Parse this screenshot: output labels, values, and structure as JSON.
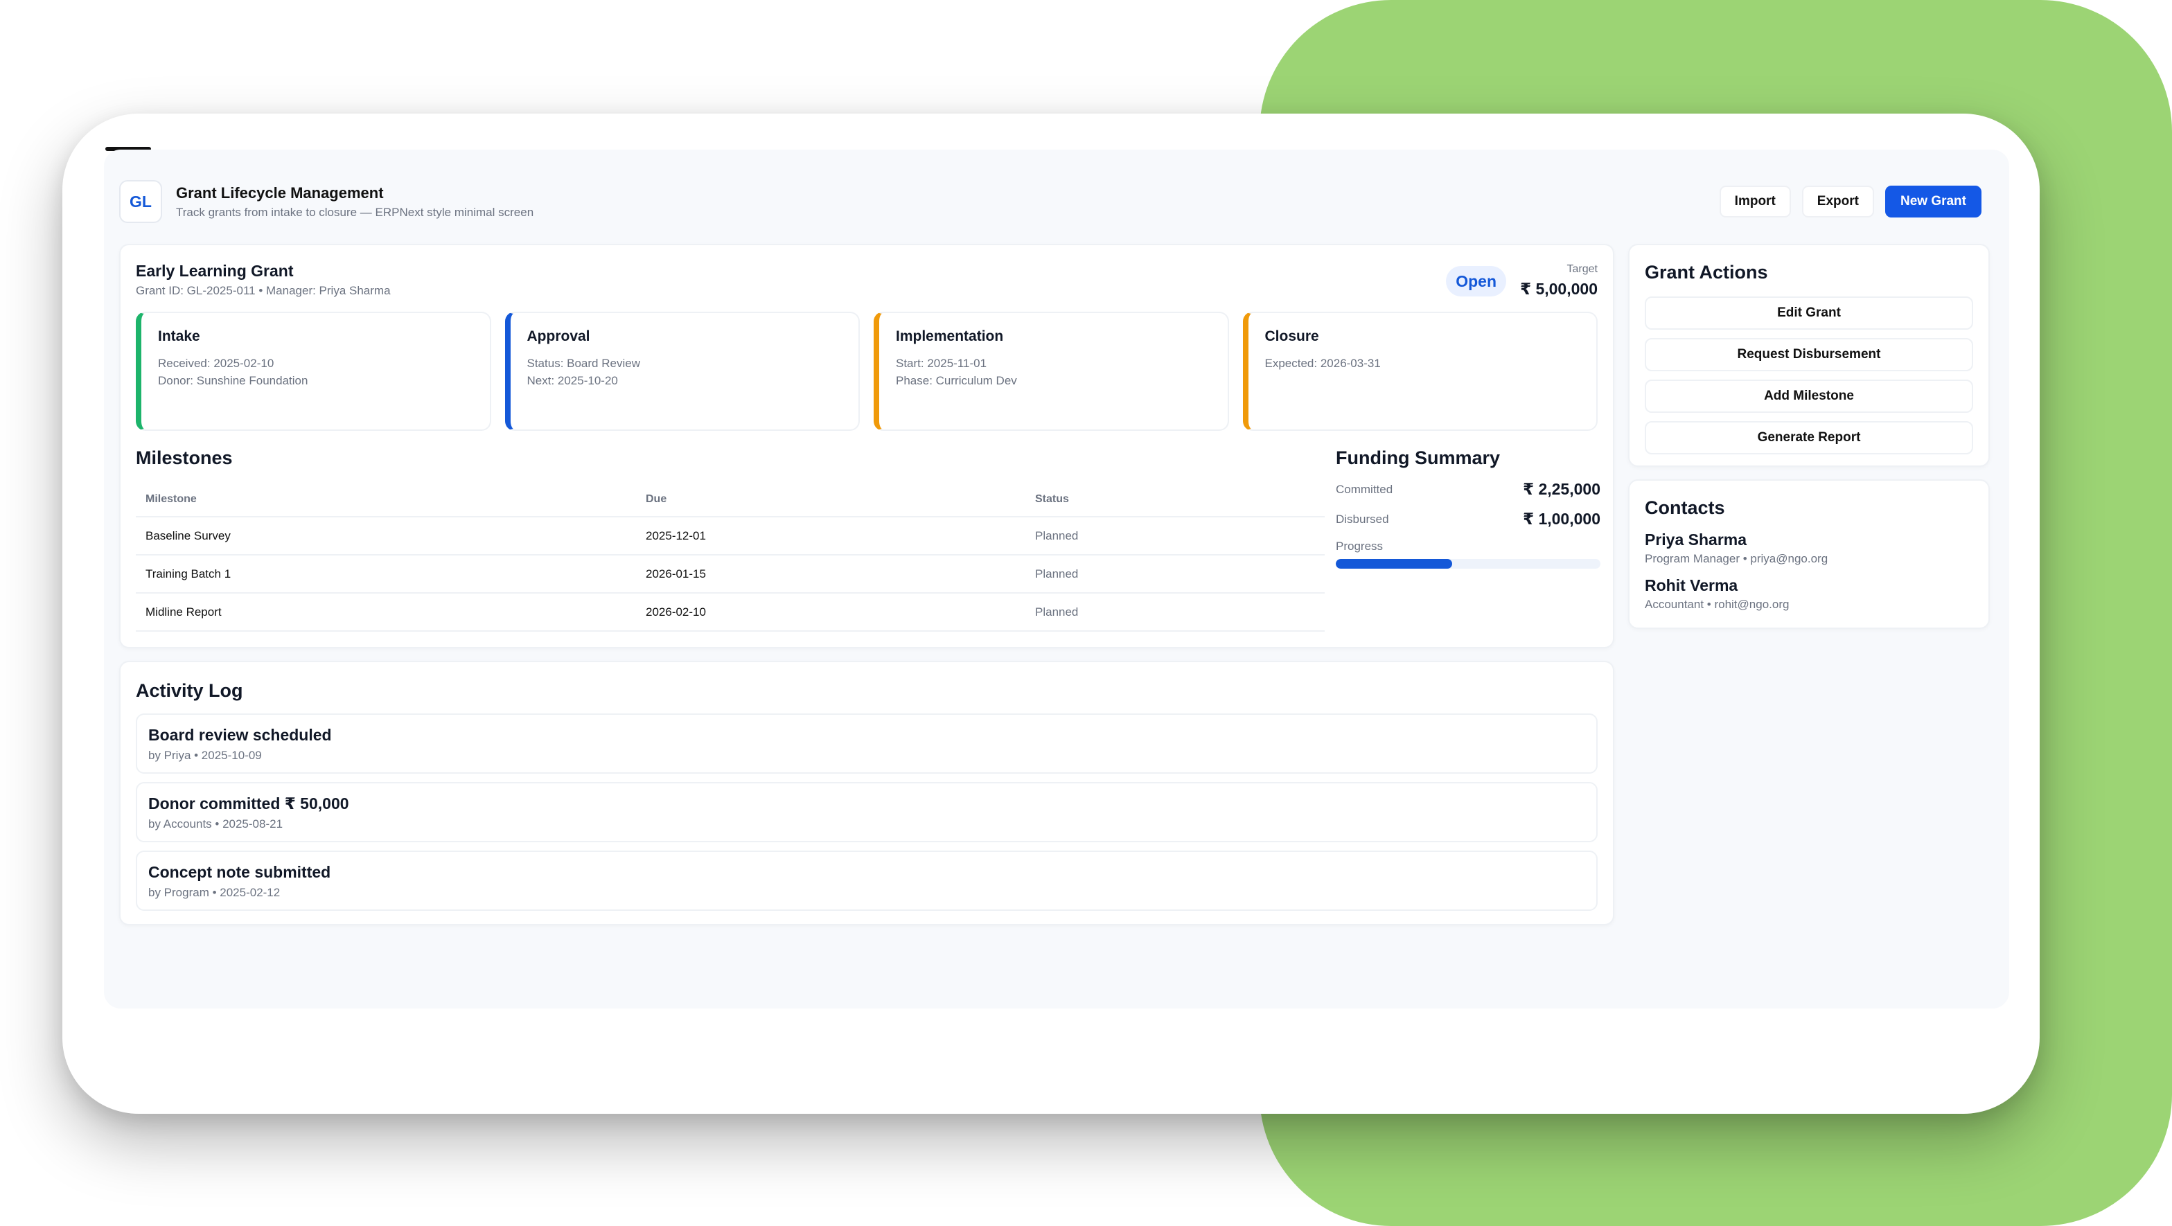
{
  "header": {
    "logo": "GL",
    "title": "Grant Lifecycle Management",
    "subtitle": "Track grants from intake to closure — ERPNext style minimal screen",
    "buttons": {
      "import": "Import",
      "export": "Export",
      "new_grant": "New Grant"
    }
  },
  "grant": {
    "title": "Early Learning Grant",
    "meta": "Grant ID: GL-2025-011 • Manager: Priya Sharma",
    "status": "Open",
    "target_label": "Target",
    "target_value": "₹ 5,00,000"
  },
  "stages": [
    {
      "title": "Intake",
      "lines": [
        "Received: 2025-02-10",
        "Donor: Sunshine Foundation"
      ],
      "color": "#1db46b"
    },
    {
      "title": "Approval",
      "lines": [
        "Status: Board Review",
        "Next: 2025-10-20"
      ],
      "color": "#1458d8"
    },
    {
      "title": "Implementation",
      "lines": [
        "Start: 2025-11-01",
        "Phase: Curriculum Dev"
      ],
      "color": "#f09a0a"
    },
    {
      "title": "Closure",
      "lines": [
        "Expected: 2026-03-31",
        ""
      ],
      "color": "#f09a0a"
    }
  ],
  "milestones": {
    "title": "Milestones",
    "columns": [
      "Milestone",
      "Due",
      "Status"
    ],
    "rows": [
      [
        "Baseline Survey",
        "2025-12-01",
        "Planned"
      ],
      [
        "Training Batch 1",
        "2026-01-15",
        "Planned"
      ],
      [
        "Midline Report",
        "2026-02-10",
        "Planned"
      ]
    ]
  },
  "funding": {
    "title": "Funding Summary",
    "committed_label": "Committed",
    "committed_value": "₹ 2,25,000",
    "disbursed_label": "Disbursed",
    "disbursed_value": "₹ 1,00,000",
    "progress_label": "Progress",
    "progress_fraction": 0.44
  },
  "grant_actions": {
    "title": "Grant Actions",
    "items": [
      "Edit Grant",
      "Request Disbursement",
      "Add Milestone",
      "Generate Report"
    ]
  },
  "contacts": {
    "title": "Contacts",
    "people": [
      {
        "name": "Priya Sharma",
        "meta": "Program Manager • priya@ngo.org"
      },
      {
        "name": "Rohit Verma",
        "meta": "Accountant • rohit@ngo.org"
      }
    ]
  },
  "activity": {
    "title": "Activity Log",
    "items": [
      {
        "title": "Board review scheduled",
        "meta": "by Priya • 2025-10-09"
      },
      {
        "title": "Donor committed ₹ 50,000",
        "meta": "by Accounts • 2025-08-21"
      },
      {
        "title": "Concept note submitted",
        "meta": "by Program • 2025-02-12"
      }
    ]
  },
  "colors": {
    "accent": "#1458e6",
    "background_shape": "#9cd474"
  }
}
